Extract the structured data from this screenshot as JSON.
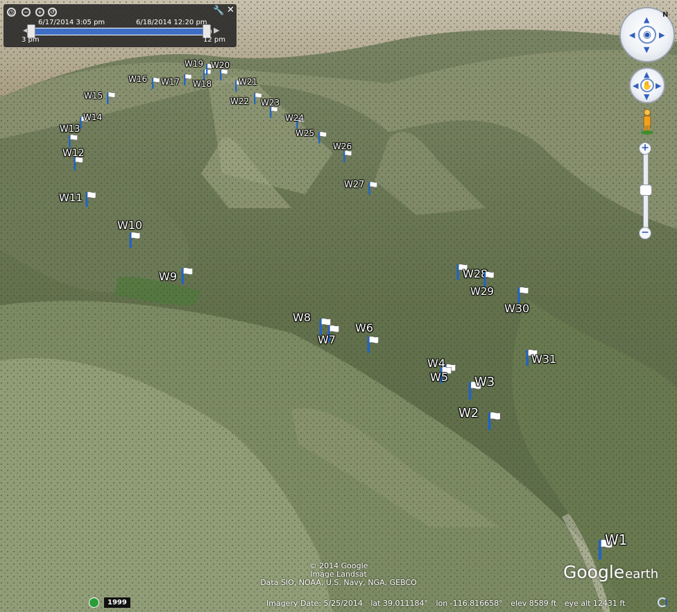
{
  "time_slider": {
    "start_datetime": "6/17/2014   3:05 pm",
    "end_datetime": "6/18/2014  12:20 pm",
    "left_tick": "3 pm",
    "right_tick": "12 pm"
  },
  "compass": {
    "north_label": "N"
  },
  "waypoints": [
    {
      "label": "W1"
    },
    {
      "label": "W2"
    },
    {
      "label": "W3"
    },
    {
      "label": "W4"
    },
    {
      "label": "W5"
    },
    {
      "label": "W6"
    },
    {
      "label": "W7"
    },
    {
      "label": "W8"
    },
    {
      "label": "W9"
    },
    {
      "label": "W10"
    },
    {
      "label": "W11"
    },
    {
      "label": "W12"
    },
    {
      "label": "W13"
    },
    {
      "label": "W14"
    },
    {
      "label": "W15"
    },
    {
      "label": "W16"
    },
    {
      "label": "W17"
    },
    {
      "label": "W18"
    },
    {
      "label": "W19"
    },
    {
      "label": "W20"
    },
    {
      "label": "W21"
    },
    {
      "label": "W22"
    },
    {
      "label": "W23"
    },
    {
      "label": "W24"
    },
    {
      "label": "W25"
    },
    {
      "label": "W26"
    },
    {
      "label": "W27"
    },
    {
      "label": "W28"
    },
    {
      "label": "W29"
    },
    {
      "label": "W30"
    },
    {
      "label": "W31"
    }
  ],
  "attribution": {
    "line1": "© 2014 Google",
    "line2": "Image Landsat",
    "line3": "Data SIO, NOAA, U.S. Navy, NGA, GEBCO"
  },
  "logo": {
    "google": "Google",
    "earth": "earth"
  },
  "status_bar": {
    "historical_year": "1999",
    "imagery_date": "Imagery Date: 5/25/2014",
    "lat": "lat  39.011184°",
    "lon": "lon -116.816658°",
    "elev": "elev  8589 ft",
    "eye_alt": "eye alt  12431 ft"
  },
  "colors": {
    "flag_pole": "#1e64c8",
    "flag": "#ffffff"
  }
}
